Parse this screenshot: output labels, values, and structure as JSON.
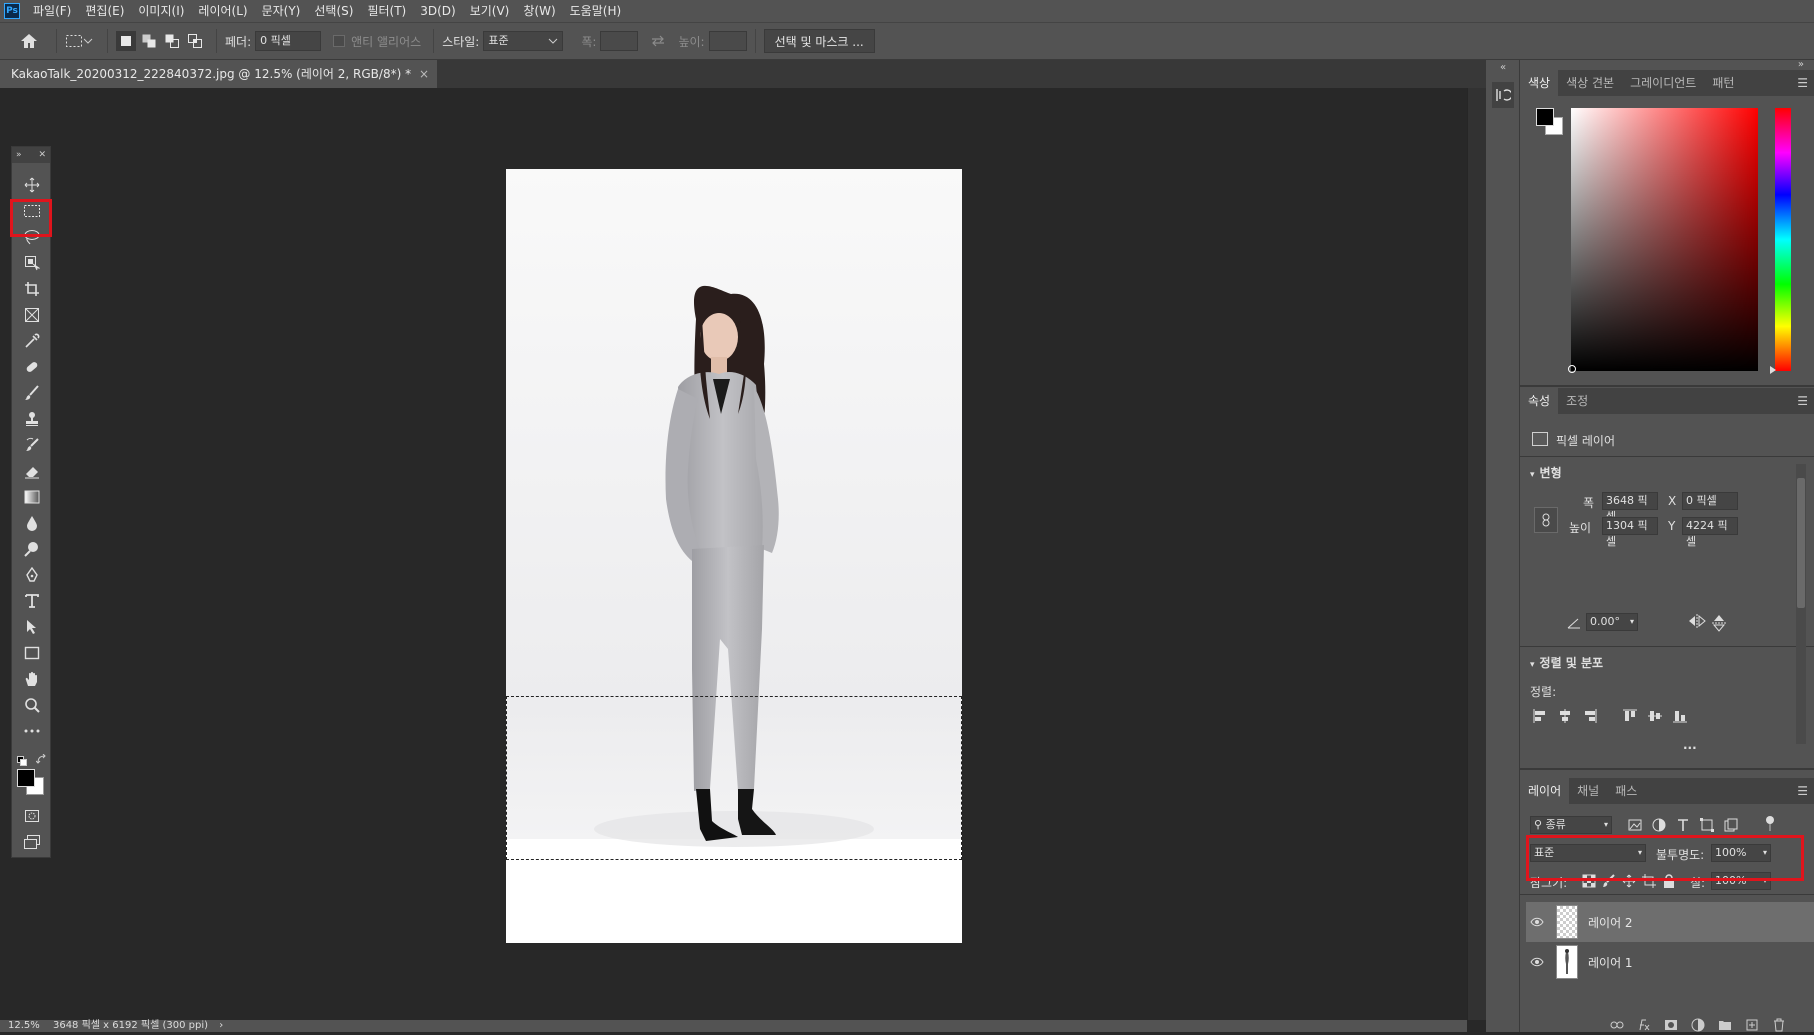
{
  "menubar": {
    "items": [
      "파일(F)",
      "편집(E)",
      "이미지(I)",
      "레이어(L)",
      "문자(Y)",
      "선택(S)",
      "필터(T)",
      "3D(D)",
      "보기(V)",
      "창(W)",
      "도움말(H)"
    ]
  },
  "options": {
    "feather_label": "페더:",
    "feather_value": "0 픽셀",
    "antialias_label": "앤티 앨리어스",
    "style_label": "스타일:",
    "style_value": "표준",
    "width_label": "폭:",
    "height_label": "높이:",
    "select_mask_label": "선택 및 마스크 ..."
  },
  "document": {
    "tab_title": "KakaoTalk_20200312_222840372.jpg @ 12.5% (레이어 2, RGB/8*) *",
    "close_glyph": "×"
  },
  "statusbar": {
    "zoom": "12.5%",
    "doc_size": "3648 픽셀 x 6192 픽셀 (300 ppi)",
    "arrow": "›"
  },
  "color_panel": {
    "tabs": [
      "색상",
      "색상 견본",
      "그레이디언트",
      "패턴"
    ],
    "colors": {
      "foreground": "#000000",
      "background": "#ffffff",
      "hue": "#ff0000"
    }
  },
  "properties_panel": {
    "tabs": [
      "속성",
      "조정"
    ],
    "layer_type": "픽셀 레이어",
    "transform_title": "변형",
    "width_label": "폭",
    "width_value": "3648 픽셀",
    "height_label": "높이",
    "height_value": "1304 픽셀",
    "x_label": "X",
    "x_value": "0 픽셀",
    "y_label": "Y",
    "y_value": "4224 픽셀",
    "angle_value": "0.00°",
    "align_title": "정렬 및 분포",
    "align_label": "정렬:",
    "more": "..."
  },
  "layers_panel": {
    "tabs": [
      "레이어",
      "채널",
      "패스"
    ],
    "filter_kind": "종류",
    "blend_mode": "표준",
    "opacity_label": "불투명도:",
    "opacity_value": "100%",
    "lock_label": "잠그기:",
    "fill_label": "칠:",
    "fill_value": "100%",
    "layers": [
      {
        "name": "레이어 2",
        "selected": true
      },
      {
        "name": "레이어 1",
        "selected": false
      }
    ]
  },
  "colors": {
    "highlight_red": "#e0141c",
    "panel_bg": "#535353",
    "canvas_bg": "#282828"
  }
}
